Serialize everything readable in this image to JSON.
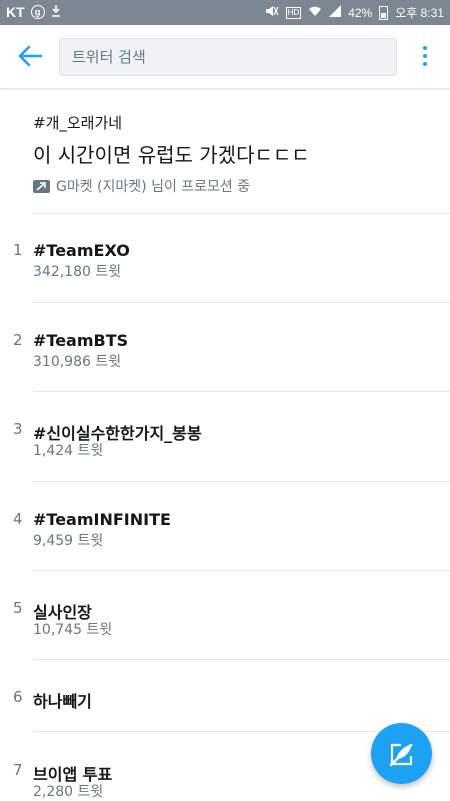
{
  "status_bar": {
    "carrier": "KT",
    "app_badge": "g",
    "battery": "42%",
    "time": "오후 8:31"
  },
  "search": {
    "placeholder": "트위터 검색"
  },
  "promoted": {
    "tag": "#개_오래가네",
    "title": "이 시간이면 유럽도 가겠다ㄷㄷㄷ",
    "by": "G마켓 (지마켓) 님이 프로모션 중"
  },
  "trends": [
    {
      "rank": "1",
      "name": "#TeamEXO",
      "count": "342,180 트윗"
    },
    {
      "rank": "2",
      "name": "#TeamBTS",
      "count": "310,986 트윗"
    },
    {
      "rank": "3",
      "name": "#신이실수한한가지_봉봉",
      "count": "1,424 트윗"
    },
    {
      "rank": "4",
      "name": "#TeamINFINITE",
      "count": "9,459 트윗"
    },
    {
      "rank": "5",
      "name": "실사인장",
      "count": "10,745 트윗"
    },
    {
      "rank": "6",
      "name": "하나빼기",
      "count": ""
    },
    {
      "rank": "7",
      "name": "브이앱 투표",
      "count": "2,280 트윗"
    }
  ],
  "colors": {
    "accent": "#1da1f2",
    "status_bar": "#7d8792",
    "secondary_text": "#657786"
  },
  "icons": {
    "back": "arrow-left-icon",
    "more": "more-vertical-icon",
    "promoted": "promoted-arrow-icon",
    "compose": "compose-tweet-icon"
  }
}
